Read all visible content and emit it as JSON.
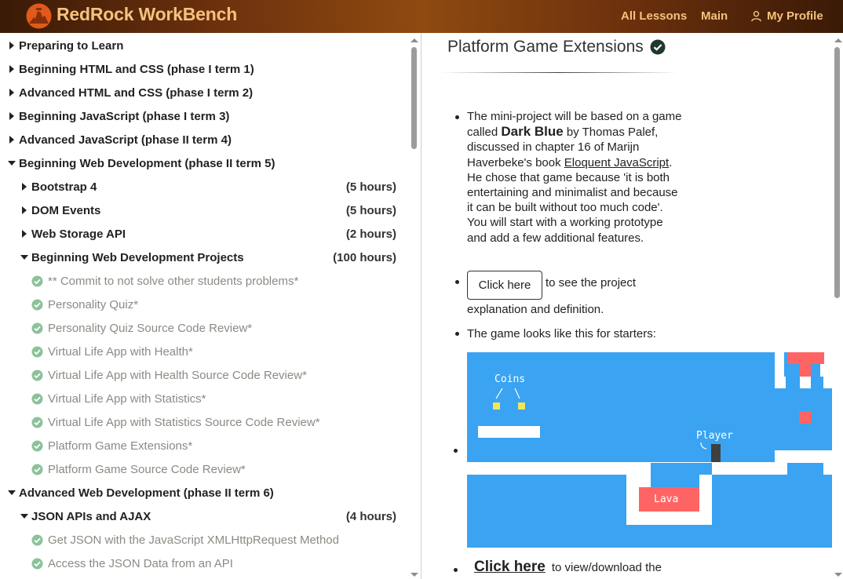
{
  "header": {
    "brand": "RedRock WorkBench",
    "nav": {
      "all_lessons": "All Lessons",
      "main": "Main",
      "profile": "My Profile"
    },
    "colors": {
      "text": "#f5c27d",
      "logo_bg": "#e05a1b"
    }
  },
  "sidebar": {
    "items": [
      {
        "label": "Preparing to Learn",
        "state": "collapsed"
      },
      {
        "label": "Beginning HTML and CSS (phase I term 1)",
        "state": "collapsed"
      },
      {
        "label": "Advanced HTML and CSS (phase I term 2)",
        "state": "collapsed"
      },
      {
        "label": "Beginning JavaScript (phase I term 3)",
        "state": "collapsed"
      },
      {
        "label": "Advanced JavaScript (phase II term 4)",
        "state": "collapsed"
      },
      {
        "label": "Beginning Web Development (phase II term 5)",
        "state": "expanded"
      },
      {
        "label": "Bootstrap 4",
        "hours": "(5 hours)",
        "state": "collapsed"
      },
      {
        "label": "DOM Events",
        "hours": "(5 hours)",
        "state": "collapsed"
      },
      {
        "label": "Web Storage API",
        "hours": "(2 hours)",
        "state": "collapsed"
      },
      {
        "label": "Beginning Web Development Projects",
        "hours": "(100 hours)",
        "state": "expanded"
      },
      {
        "label": "** Commit to not solve other students problems*",
        "state": "done"
      },
      {
        "label": "Personality Quiz*",
        "state": "done"
      },
      {
        "label": "Personality Quiz Source Code Review*",
        "state": "done"
      },
      {
        "label": "Virtual Life App with Health*",
        "state": "done"
      },
      {
        "label": "Virtual Life App with Health Source Code Review*",
        "state": "done"
      },
      {
        "label": "Virtual Life App with Statistics*",
        "state": "done"
      },
      {
        "label": "Virtual Life App with Statistics Source Code Review*",
        "state": "done"
      },
      {
        "label": "Platform Game Extensions*",
        "state": "done"
      },
      {
        "label": "Platform Game Source Code Review*",
        "state": "done"
      },
      {
        "label": "Advanced Web Development (phase II term 6)",
        "state": "expanded"
      },
      {
        "label": "JSON APIs and AJAX",
        "hours": "(4 hours)",
        "state": "expanded"
      },
      {
        "label": "Get JSON with the JavaScript XMLHttpRequest Method",
        "state": "done"
      },
      {
        "label": "Access the JSON Data from an API",
        "state": "done"
      }
    ]
  },
  "main": {
    "title": "Platform Game Extensions",
    "bullet1": {
      "text_before": "The mini-project will be based on a game called ",
      "game_name": "Dark Blue",
      "text_mid": " by Thomas Palef, discussed in chapter 16 of Marijn Haverbeke's book ",
      "book_link": "Eloquent JavaScript",
      "text_after": ". He chose that game because 'it is both entertaining and minimalist and because it can be built without too much code'. You will start with a working prototype and add a few additional features."
    },
    "bullet2": {
      "button": "Click here",
      "text": " to see the project",
      "text_line2": "explanation and definition."
    },
    "bullet3": {
      "text": "The game looks like this for starters:"
    },
    "game_image": {
      "coins_label": "Coins",
      "player_label": "Player",
      "lava_label": "Lava",
      "colors": {
        "sky": "#3aa3f2",
        "wall": "#ffffff",
        "lava": "#ff6464",
        "coin": "#f1e559",
        "player": "#404040"
      }
    },
    "bullet4": {
      "link": "Click here",
      "text": " to view/download the"
    }
  }
}
